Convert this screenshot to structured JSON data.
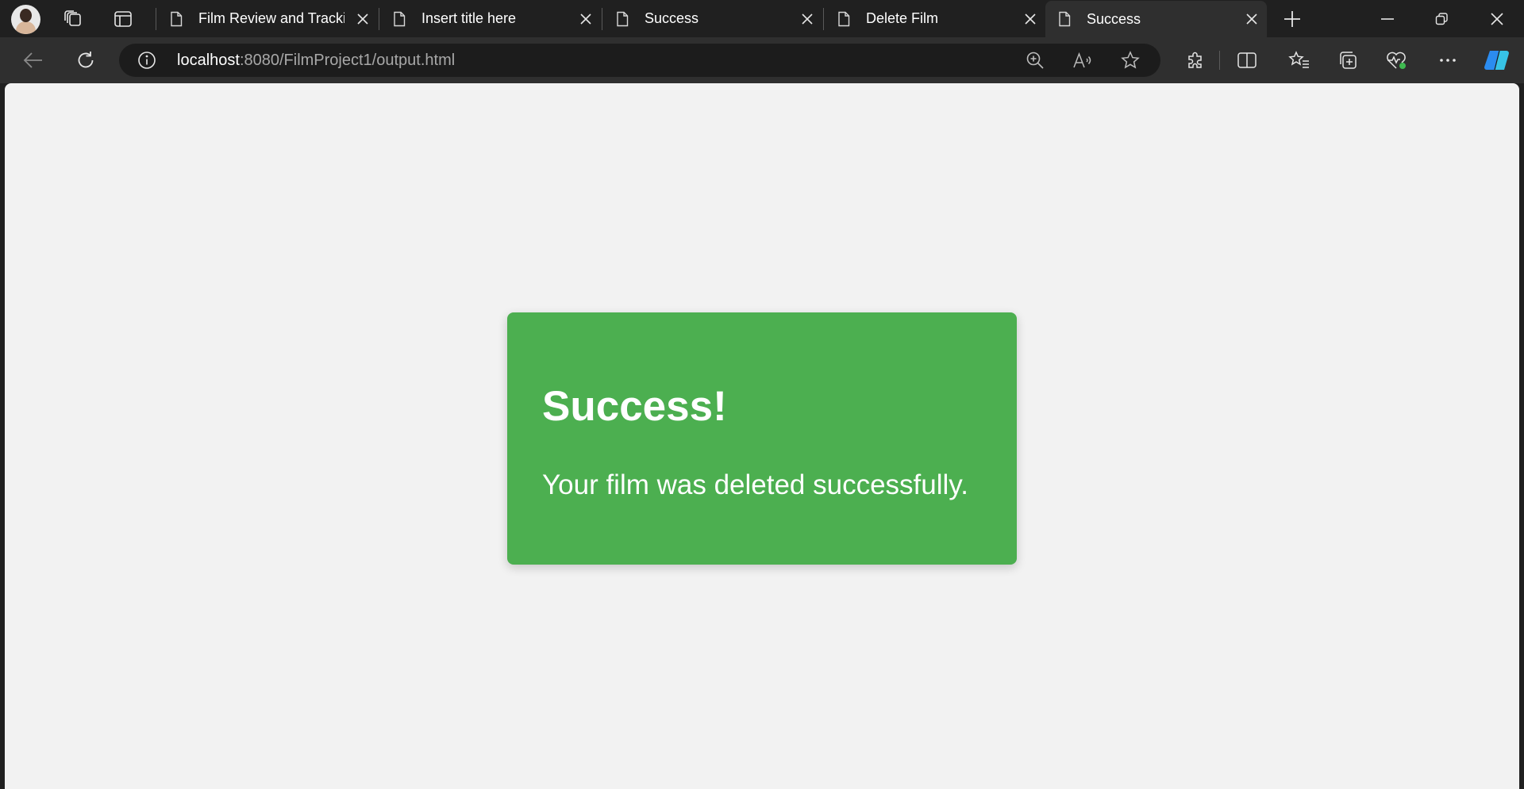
{
  "browser": {
    "tabs": [
      {
        "label": "Film Review and Tracking",
        "active": false
      },
      {
        "label": "Insert title here",
        "active": false
      },
      {
        "label": "Success",
        "active": false
      },
      {
        "label": "Delete Film",
        "active": false
      },
      {
        "label": "Success",
        "active": true
      }
    ],
    "address": {
      "host": "localhost",
      "rest": ":8080/FilmProject1/output.html"
    },
    "icons": {
      "avatar": "profile-avatar",
      "workspaces": "workspaces-icon",
      "tab_actions": "vertical-tabs-icon",
      "new_tab": "plus-icon",
      "minimize": "minimize-icon",
      "restore": "restore-icon",
      "close_window": "close-icon",
      "back": "back-arrow-icon",
      "refresh": "refresh-icon",
      "site_info": "info-icon",
      "zoom": "zoom-in-icon",
      "read_aloud": "read-aloud-icon",
      "favorite": "star-icon",
      "extensions": "puzzle-icon",
      "split_screen": "split-screen-icon",
      "favorites": "favorites-list-icon",
      "collections": "collections-icon",
      "browser_essentials": "heart-pulse-icon",
      "more": "more-dots-icon",
      "copilot": "copilot-icon"
    },
    "colors": {
      "chrome_dark": "#202020",
      "toolbar": "#2f2f2f",
      "page_bg": "#f2f2f2"
    }
  },
  "page": {
    "heading": "Success!",
    "message": "Your film was deleted successfully.",
    "card_color": "#4caf50"
  }
}
